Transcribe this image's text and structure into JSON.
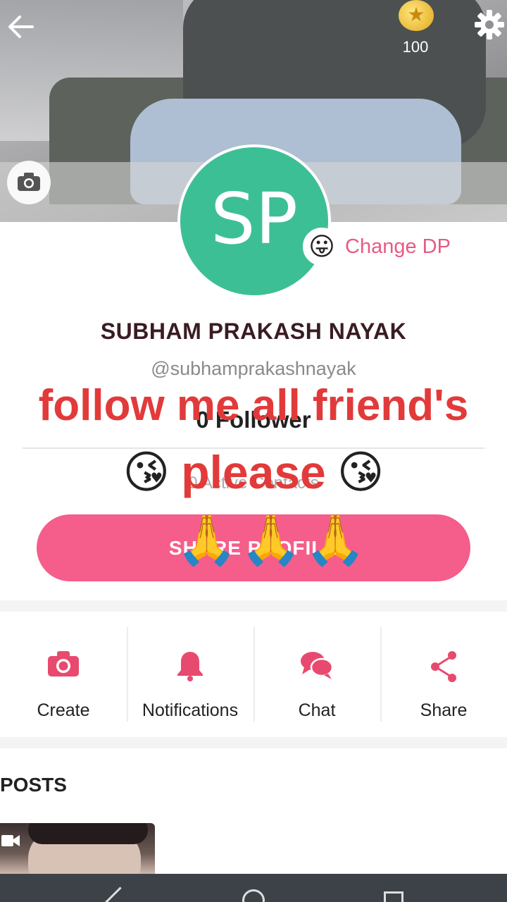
{
  "cover": {
    "coin_count": "100"
  },
  "profile": {
    "avatar_initials": "SP",
    "avatar_color": "#3dbf96",
    "change_dp_emoji": "😛",
    "change_dp_label": "Change DP",
    "name": "SUBHAM PRAKASH NAYAK",
    "handle": "@subhamprakashnayak",
    "followers": "0 Follower",
    "sub_stat": "0 Active Contacts",
    "share_button_label": "SHARE PROFILE"
  },
  "overlay": {
    "line1": "follow me all friend's",
    "line2_word": "please",
    "kiss_emoji": "😘",
    "pray_emoji": "🙏"
  },
  "actions": [
    {
      "label": "Create",
      "icon": "camera-icon"
    },
    {
      "label": "Notifications",
      "icon": "bell-icon"
    },
    {
      "label": "Chat",
      "icon": "chat-icon"
    },
    {
      "label": "Share",
      "icon": "share-icon"
    }
  ],
  "posts": {
    "title": "POSTS"
  },
  "colors": {
    "accent_pink": "#f55d8b",
    "icon_pink": "#e84a6f",
    "overlay_red": "#e23a3a"
  }
}
